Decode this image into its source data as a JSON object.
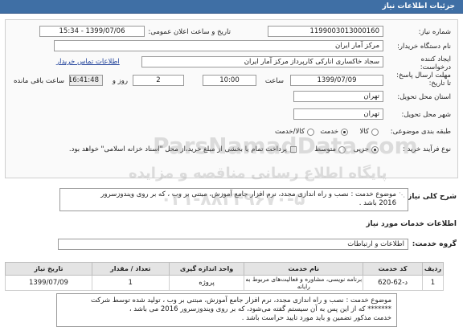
{
  "header": {
    "title": "جزئیات اطلاعات نیاز"
  },
  "form": {
    "need_number_label": "شماره نیاز:",
    "need_number": "1199003013000160",
    "announce_label": "تاریخ و ساعت اعلان عمومی:",
    "announce_value": "1399/07/06 - 15:34",
    "buyer_label": "نام دستگاه خریدار:",
    "buyer_value": "مرکز آمار ایران",
    "creator_label": "ایجاد کننده درخواست:",
    "creator_value": "سجاد خاکساری  انارکی کارپرداز مرکز آمار ایران",
    "contact_link": "اطلاعات تماس خریدار",
    "deadline_label": "مهلت ارسال پاسخ:  تا تاریخ:",
    "deadline_date": "1399/07/09",
    "time_label": "ساعت",
    "deadline_time": "10:00",
    "days_value": "2",
    "days_label": "روز و",
    "remaining_time": "16:41:48",
    "remaining_label": "ساعت باقی مانده",
    "province_label": "استان محل تحویل:",
    "province_value": "تهران",
    "city_label": "شهر محل تحویل:",
    "city_value": "تهران",
    "category_label": "طبقه بندی موضوعی:",
    "category_options": [
      "کالا",
      "خدمت",
      "کالا/خدمت"
    ],
    "category_selected": "خدمت",
    "process_label": "نوع فرآیند خرید :",
    "process_options": [
      "جزیی",
      "متوسط"
    ],
    "process_selected": "جزیی",
    "payment_note": "پرداخت تمام یا بخشی از مبلغ خرید،از محل \"اسناد خزانه اسلامی\" خواهد بود."
  },
  "description": {
    "label": "شرح کلی نیاز:",
    "line1": "موضوع خدمت : نصب و راه اندازی مجدد، نرم افزار جامع آموزش، مبتنی بر وب  ،  که بر روی ویندوزسرور",
    "line2": "2016  باشد ."
  },
  "services": {
    "title": "اطلاعات خدمات مورد نیاز",
    "group_label": "گروه خدمت:",
    "group_value": "اطلاعات و ارتباطات",
    "columns": [
      "ردیف",
      "کد خدمت",
      "نام خدمت",
      "واحد اندازه گیری",
      "تعداد / مقدار",
      "تاریخ نیاز"
    ],
    "rows": [
      [
        "1",
        "د-62-620",
        "برنامه نویسی، مشاوره و فعالیت‌های مربوط به رایانه",
        "پروژه",
        "1",
        "1399/07/09"
      ]
    ]
  },
  "notes": {
    "line1": "موضوع خدمت : نصب و راه اندازی مجدد، نرم افزار جامع آموزش، مبتنی بر وب ،  تولید شده توسط شرکت",
    "line2": "******* که از این پس به آن سیستم گفته می‌شود،  که بر روی ویندوزسرور 2016 می باشد ،",
    "line3": "خدمت مذکور تضمین و باید مورد تایید حراست باشد ."
  },
  "watermark": {
    "line1": "ParsNamadData.com",
    "line2": "پایگاه اطلاع رسانی مناقصه و مزایده",
    "line3": "۰۲۱-۸۸۳۴۹۶۷۰-۵"
  }
}
